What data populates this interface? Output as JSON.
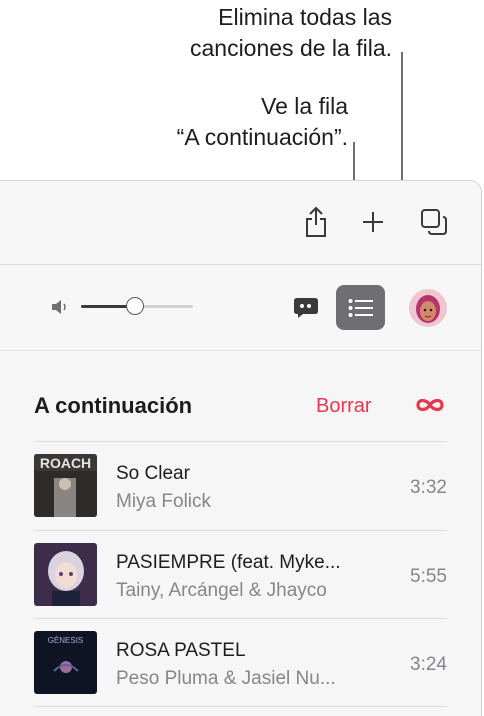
{
  "callouts": {
    "clear_line1": "Elimina todas las",
    "clear_line2": "canciones de la fila.",
    "queue_line1": "Ve la fila",
    "queue_line2": "“A continuación”."
  },
  "toolbar": {
    "share_icon": "share-icon",
    "add_icon": "plus-icon",
    "miniplayer_icon": "copy-window-icon"
  },
  "player": {
    "volume_icon": "speaker-icon",
    "volume_level": 0.48,
    "lyrics_icon": "lyrics-bubble-icon",
    "queue_icon": "list-icon",
    "avatar_icon": "memoji-avatar"
  },
  "queue": {
    "title": "A continuación",
    "clear_label": "Borrar",
    "autoplay_icon": "infinity-icon",
    "accent_color": "#e8364f",
    "songs": [
      {
        "title": "So Clear",
        "artist": "Miya Folick",
        "duration": "3:32",
        "art_text": "ROACH"
      },
      {
        "title": "PASIEMPRE (feat. Myke...",
        "artist": "Tainy, Arcángel & Jhayco",
        "duration": "5:55"
      },
      {
        "title": "ROSA PASTEL",
        "artist": "Peso Pluma & Jasiel Nu...",
        "duration": "3:24",
        "art_text": "GÉNESIS"
      }
    ]
  }
}
